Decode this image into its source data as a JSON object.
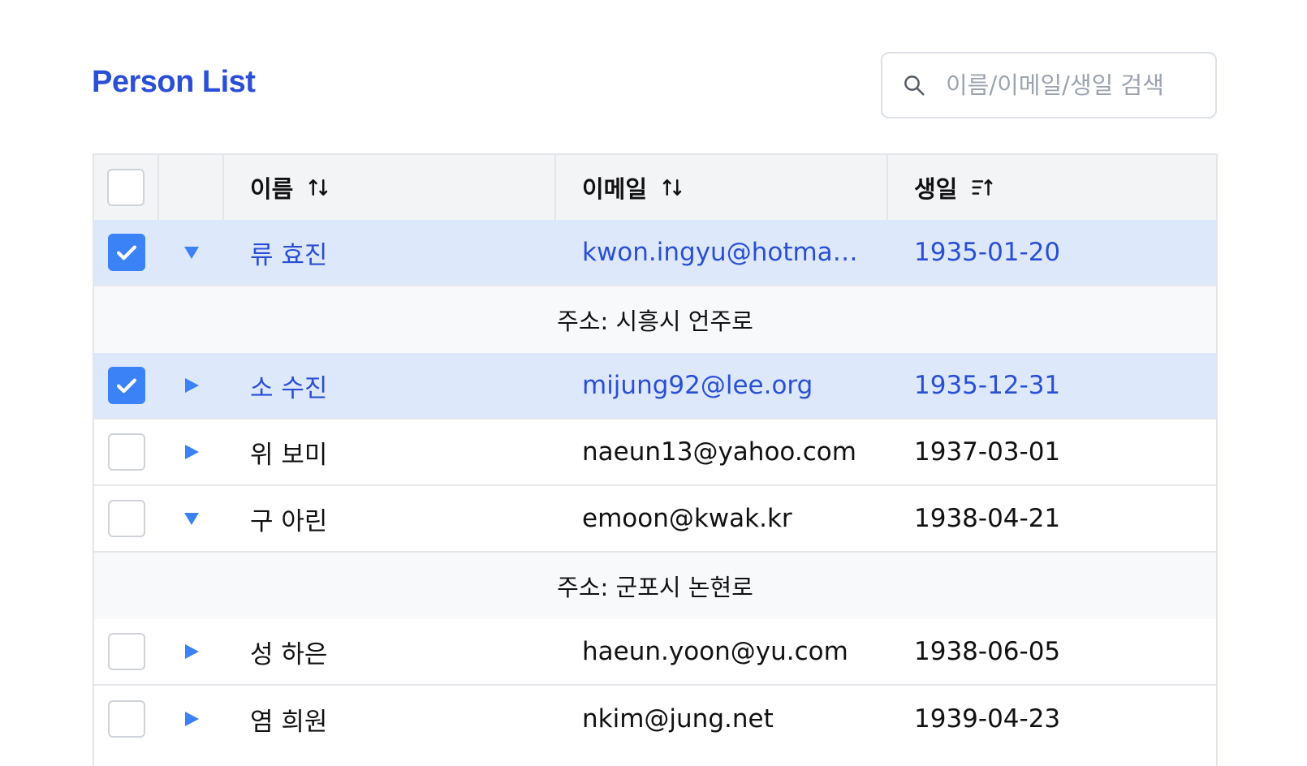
{
  "title": "Person List",
  "search": {
    "placeholder": "이름/이메일/생일 검색",
    "value": ""
  },
  "colors": {
    "accent": "#2a4fd6",
    "checkbox_checked": "#3b82f6",
    "selected_row": "#dee8fb",
    "header_bg": "#f3f4f6"
  },
  "columns": {
    "name": "이름",
    "email": "이메일",
    "birth": "생일"
  },
  "sort_icons": {
    "name": "sort-both-icon",
    "email": "sort-both-icon",
    "birth": "sort-ascending-icon"
  },
  "header_checkbox_checked": false,
  "rows": [
    {
      "checked": true,
      "expanded": true,
      "name": "류 효진",
      "email": "kwon.ingyu@hotmail.com",
      "birth": "1935-01-20",
      "detail": "주소: 시흥시 언주로"
    },
    {
      "checked": true,
      "expanded": false,
      "name": "소 수진",
      "email": "mijung92@lee.org",
      "birth": "1935-12-31"
    },
    {
      "checked": false,
      "expanded": false,
      "name": "위 보미",
      "email": "naeun13@yahoo.com",
      "birth": "1937-03-01"
    },
    {
      "checked": false,
      "expanded": true,
      "name": "구 아린",
      "email": "emoon@kwak.kr",
      "birth": "1938-04-21",
      "detail": "주소: 군포시 논현로"
    },
    {
      "checked": false,
      "expanded": false,
      "name": "성 하은",
      "email": "haeun.yoon@yu.com",
      "birth": "1938-06-05"
    },
    {
      "checked": false,
      "expanded": false,
      "name": "염 희원",
      "email": "nkim@jung.net",
      "birth": "1939-04-23"
    }
  ]
}
